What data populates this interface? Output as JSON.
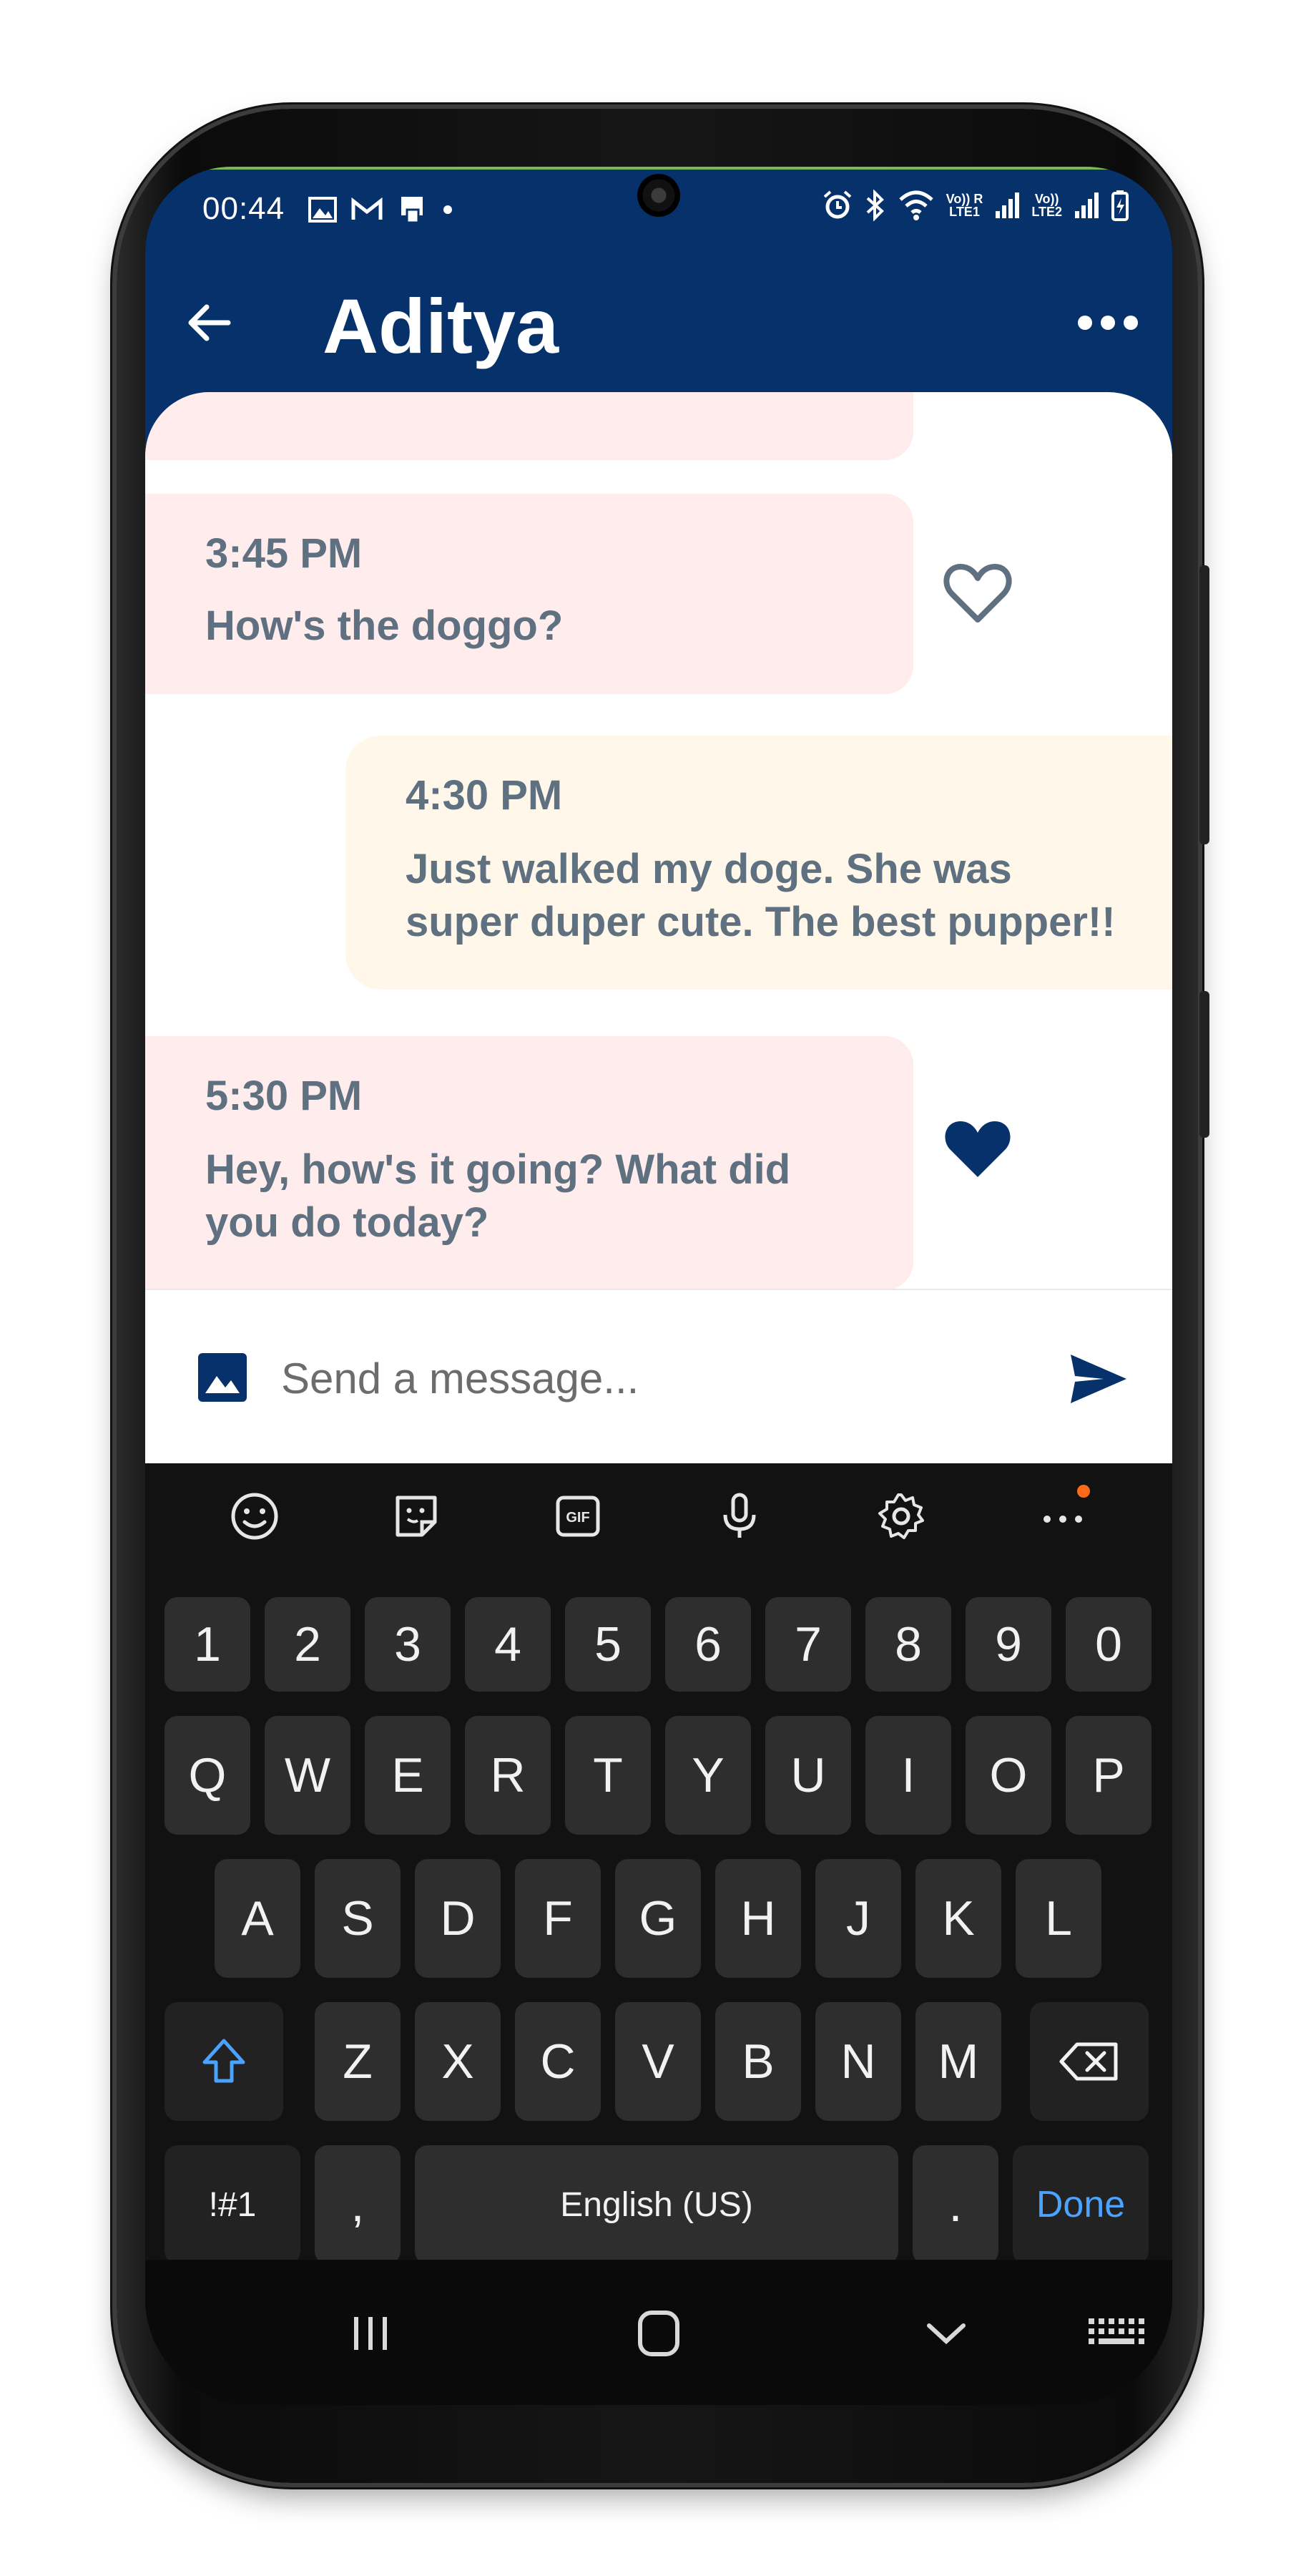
{
  "status_bar": {
    "time": "00:44",
    "net1_label": "Vo)) R",
    "net1_sub": "LTE1",
    "net2_label": "Vo))",
    "net2_sub": "LTE2"
  },
  "app_bar": {
    "title": "Aditya",
    "back_icon": "arrow-left-icon",
    "menu_icon": "more-horizontal-icon",
    "background": "#07316b"
  },
  "messages": [
    {
      "sender": "them",
      "time": "3:45 PM",
      "text": "How's the doggo?",
      "liked": false
    },
    {
      "sender": "me",
      "time": "4:30 PM",
      "text_lines": [
        "Just walked my doge. She was",
        "super duper cute. The best pupper!!"
      ]
    },
    {
      "sender": "them",
      "time": "5:30 PM",
      "text_lines": [
        "Hey, how's it going? What did",
        "you do today?"
      ],
      "liked": true
    }
  ],
  "composer": {
    "placeholder": "Send a message...",
    "image_icon": "image-icon",
    "send_icon": "send-icon"
  },
  "keyboard": {
    "toolbar": [
      "emoji-icon",
      "sticker-icon",
      "gif-icon",
      "microphone-icon",
      "settings-icon",
      "more-icon"
    ],
    "gif_label": "GIF",
    "row_numbers": [
      "1",
      "2",
      "3",
      "4",
      "5",
      "6",
      "7",
      "8",
      "9",
      "0"
    ],
    "row_top": [
      "Q",
      "W",
      "E",
      "R",
      "T",
      "Y",
      "U",
      "I",
      "O",
      "P"
    ],
    "row_middle": [
      "A",
      "S",
      "D",
      "F",
      "G",
      "H",
      "J",
      "K",
      "L"
    ],
    "row_bottom": [
      "Z",
      "X",
      "C",
      "V",
      "B",
      "N",
      "M"
    ],
    "symbols_label": "!#1",
    "comma_label": ",",
    "space_label": "English (US)",
    "period_label": ".",
    "done_label": "Done",
    "accent_color": "#4aa3ff"
  },
  "colors": {
    "incoming_bubble": "#ffecec",
    "outgoing_bubble": "#fff8ea",
    "message_text": "#5f7080",
    "heart": "#07316b"
  }
}
